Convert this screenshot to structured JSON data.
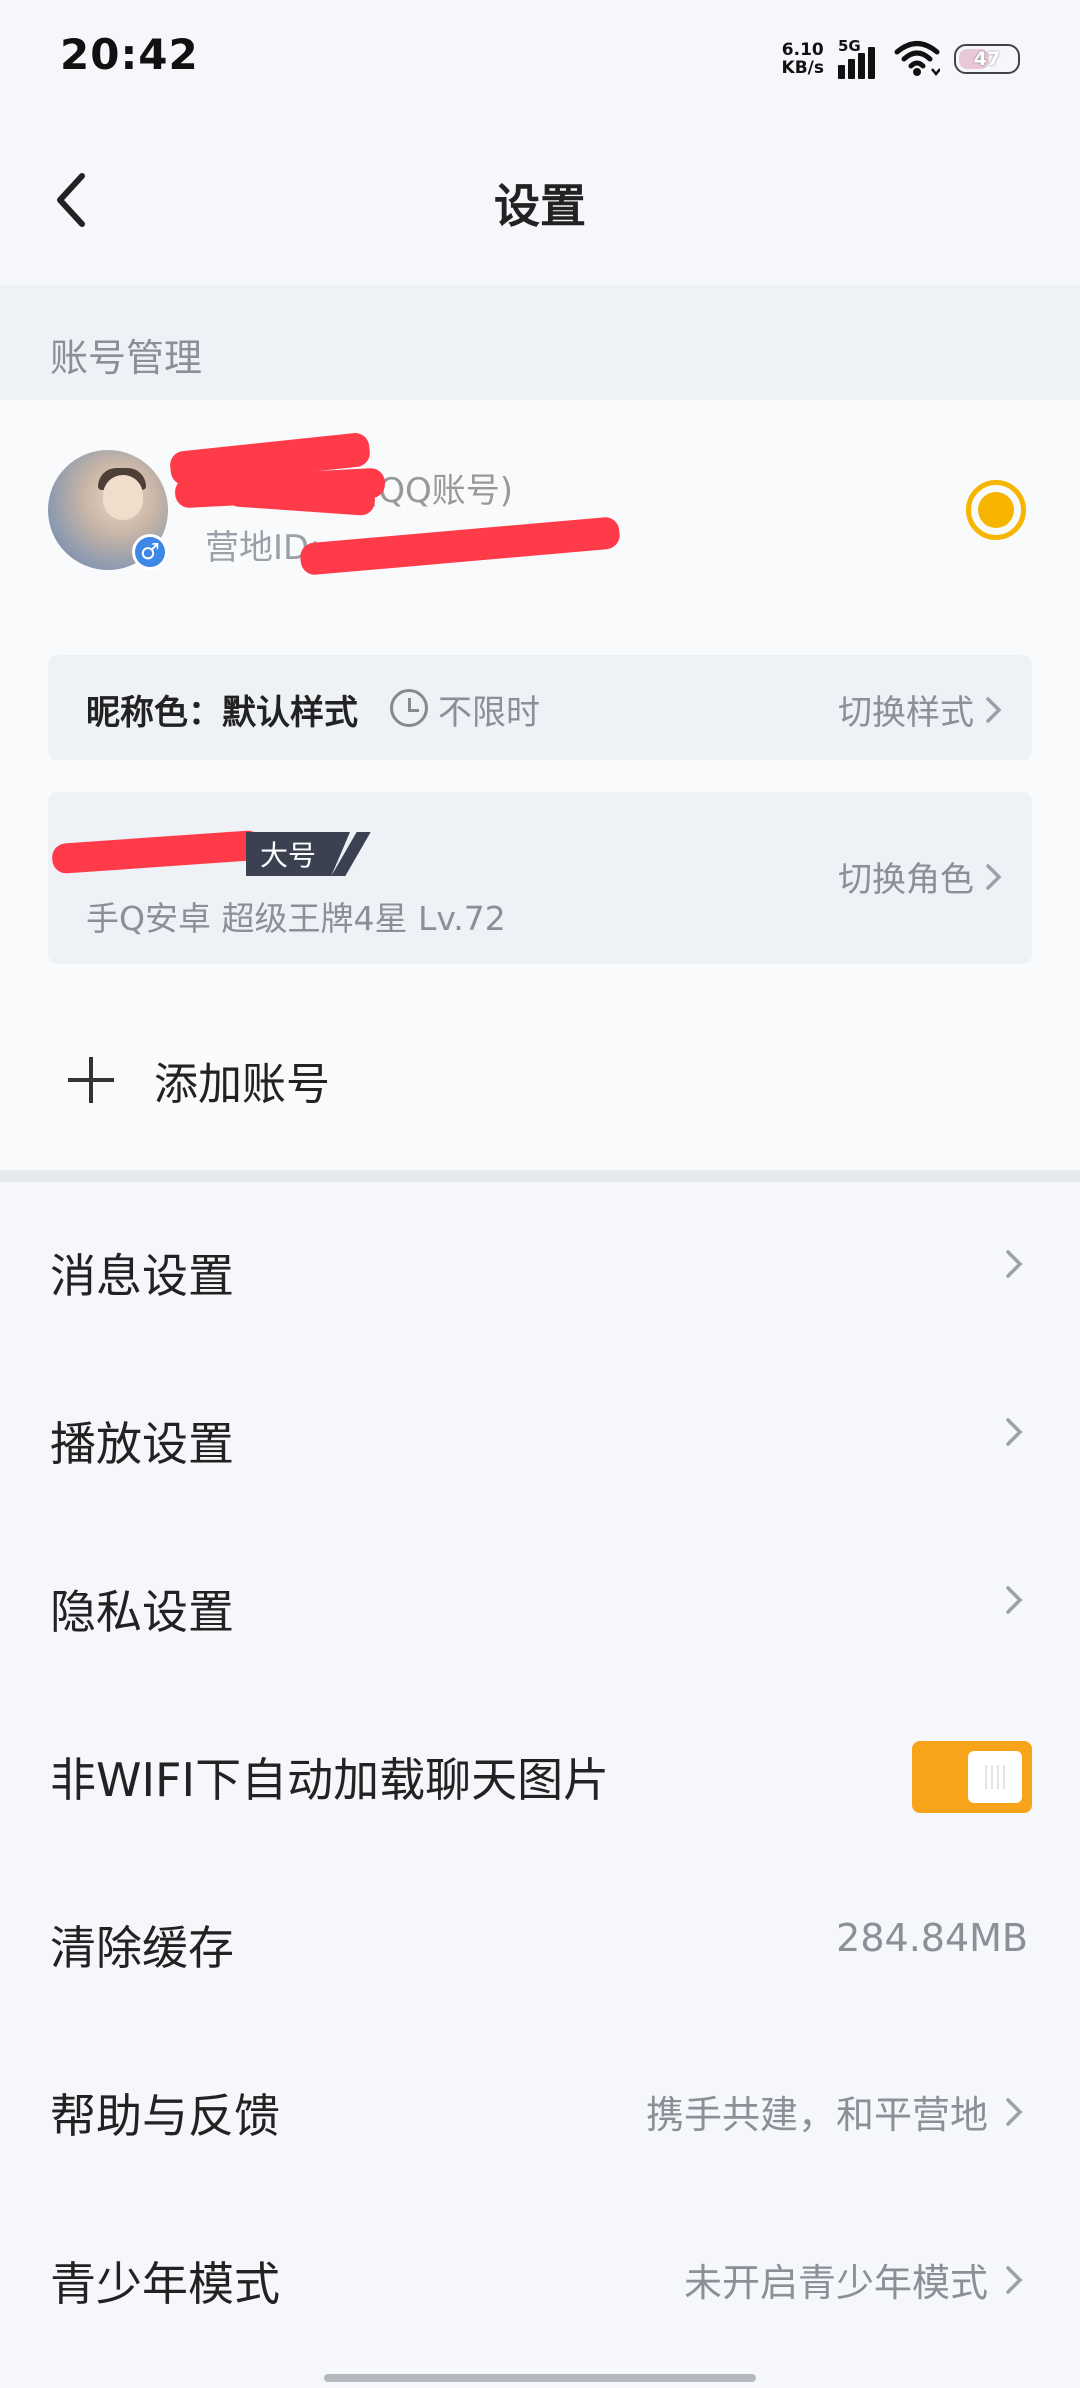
{
  "status_bar": {
    "time": "20:42",
    "speed_value": "6.10",
    "speed_unit": "KB/s",
    "network": "5G",
    "battery": "47"
  },
  "header": {
    "title": "设置",
    "back_icon": "chevron-left-icon"
  },
  "account_section": {
    "title": "账号管理",
    "nickname_suffix": "(QQ账号)",
    "camp_id_label": "营地ID:",
    "nickname_color": {
      "label": "昵称色：默认样式",
      "limit": "不限时",
      "action": "切换样式"
    },
    "role": {
      "tag": "大号",
      "meta": "手Q安卓  超级王牌4星  Lv.72",
      "action": "切换角色"
    },
    "add_account": "添加账号"
  },
  "settings": {
    "message": {
      "label": "消息设置"
    },
    "playback": {
      "label": "播放设置"
    },
    "privacy": {
      "label": "隐私设置"
    },
    "auto_load_images": {
      "label": "非WIFI下自动加载聊天图片",
      "enabled": true
    },
    "clear_cache": {
      "label": "清除缓存",
      "value": "284.84MB"
    },
    "help_feedback": {
      "label": "帮助与反馈",
      "value": "携手共建，和平营地"
    },
    "teen_mode": {
      "label": "青少年模式",
      "value": "未开启青少年模式"
    }
  },
  "colors": {
    "accent": "#f7a41b",
    "selected": "#f7b500",
    "redaction": "#ff3b4a"
  }
}
